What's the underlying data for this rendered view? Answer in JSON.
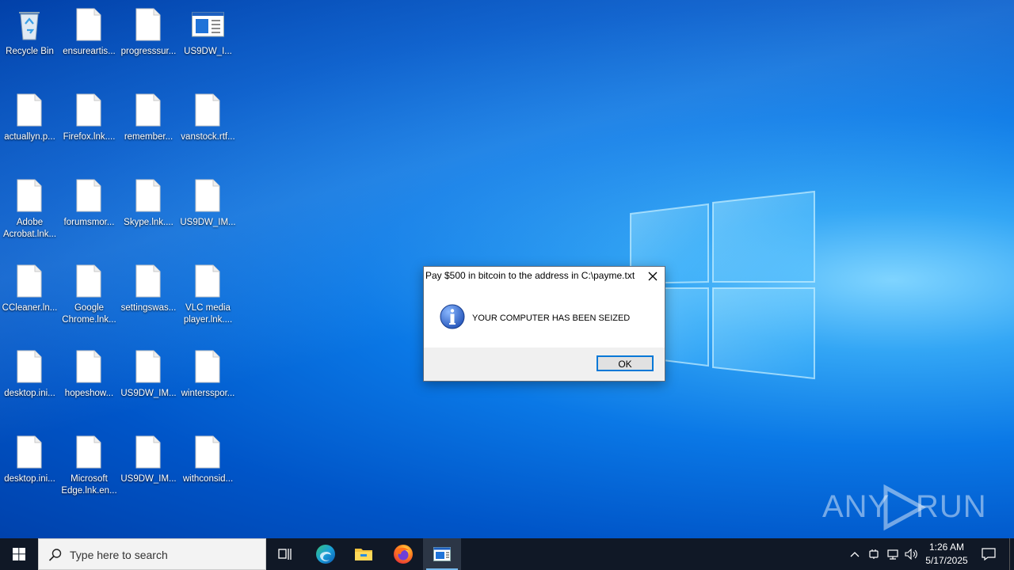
{
  "desktop": {
    "icons": [
      {
        "label": "Recycle Bin",
        "icon": "recycle-bin-icon"
      },
      {
        "label": "ensureartis...",
        "icon": "file-icon"
      },
      {
        "label": "progresssur...",
        "icon": "file-icon"
      },
      {
        "label": "US9DW_I...",
        "icon": "app-window-icon"
      },
      {
        "label": "actuallyn.p...",
        "icon": "file-icon"
      },
      {
        "label": "Firefox.lnk....",
        "icon": "file-icon"
      },
      {
        "label": "remember...",
        "icon": "file-icon"
      },
      {
        "label": "vanstock.rtf...",
        "icon": "file-icon"
      },
      {
        "label": "Adobe Acrobat.lnk...",
        "icon": "file-icon"
      },
      {
        "label": "forumsmor...",
        "icon": "file-icon"
      },
      {
        "label": "Skype.lnk....",
        "icon": "file-icon"
      },
      {
        "label": "US9DW_IM...",
        "icon": "file-icon"
      },
      {
        "label": "CCleaner.ln...",
        "icon": "file-icon"
      },
      {
        "label": "Google Chrome.lnk...",
        "icon": "file-icon"
      },
      {
        "label": "settingswas...",
        "icon": "file-icon"
      },
      {
        "label": "VLC media player.lnk....",
        "icon": "file-icon"
      },
      {
        "label": "desktop.ini...",
        "icon": "file-icon"
      },
      {
        "label": "hopeshow...",
        "icon": "file-icon"
      },
      {
        "label": "US9DW_IM...",
        "icon": "file-icon"
      },
      {
        "label": "wintersspor...",
        "icon": "file-icon"
      },
      {
        "label": "desktop.ini...",
        "icon": "file-icon"
      },
      {
        "label": "Microsoft Edge.lnk.en...",
        "icon": "file-icon"
      },
      {
        "label": "US9DW_IM...",
        "icon": "file-icon"
      },
      {
        "label": "withconsid...",
        "icon": "file-icon"
      }
    ]
  },
  "dialog": {
    "title": "Pay $500 in bitcoin to the address in C:\\payme.txt",
    "message": "YOUR COMPUTER HAS BEEN SEIZED",
    "ok_label": "OK",
    "icon": "info-icon"
  },
  "watermark": {
    "text_left": "ANY",
    "text_right": "RUN"
  },
  "taskbar": {
    "search_placeholder": "Type here to search",
    "apps": [
      "task-view-icon",
      "edge-icon",
      "file-explorer-icon",
      "firefox-icon",
      "message-box-app-icon"
    ],
    "clock": {
      "time": "1:26 AM",
      "date": "5/17/2025"
    }
  },
  "colors": {
    "taskbar_bg": "#101826",
    "accent": "#0078d7",
    "wallpaper_blue": "#0a78e6"
  }
}
